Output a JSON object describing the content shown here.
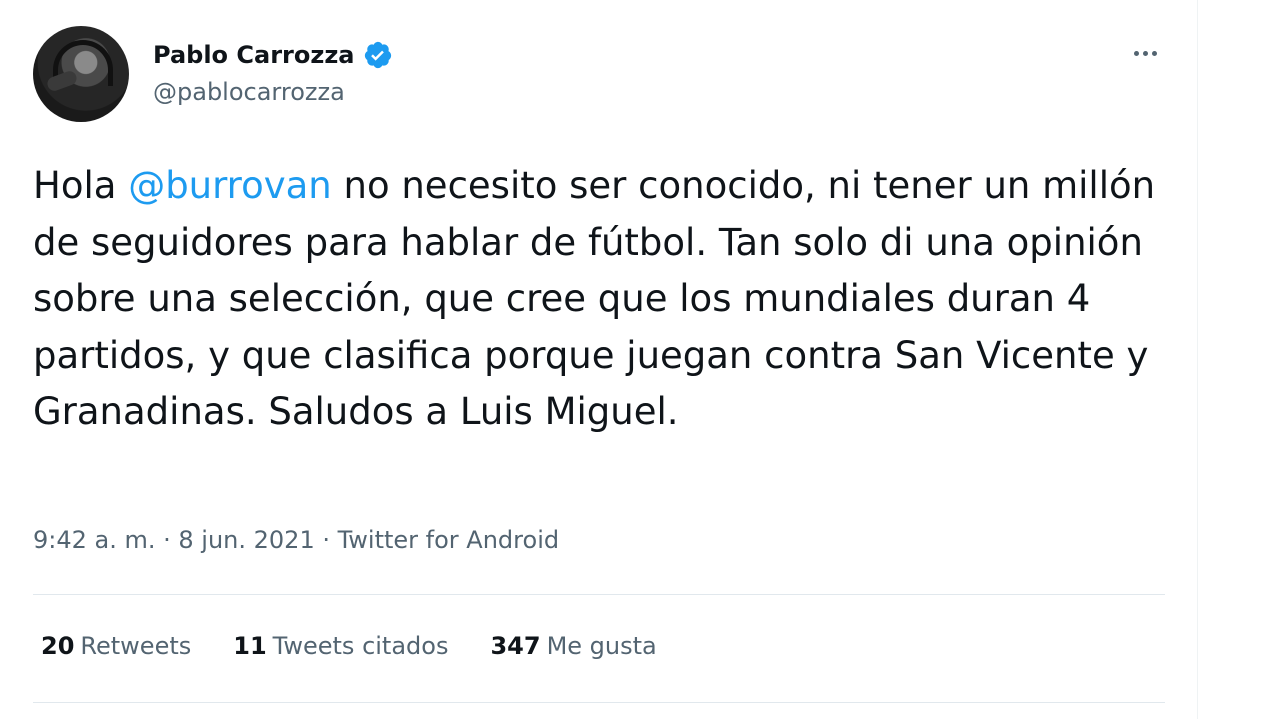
{
  "author": {
    "display_name": "Pablo Carrozza",
    "handle": "@pablocarrozza",
    "verified_icon": "verified-badge-icon",
    "verified_color": "#1d9bf0"
  },
  "tweet": {
    "text_before": "Hola ",
    "mention": "@burrovan",
    "text_after": " no necesito ser conocido, ni tener un millón de seguidores para hablar de fútbol. Tan solo di una opinión sobre una selección, que cree que los mundiales duran 4 partidos, y que clasifica porque juegan contra San Vicente y Granadinas. Saludos a Luis Miguel."
  },
  "meta": {
    "time": "9:42 a. m.",
    "separator": " · ",
    "date": "8 jun. 2021",
    "source": "Twitter for Android"
  },
  "stats": {
    "retweets_count": "20",
    "retweets_label": "Retweets",
    "quotes_count": "11",
    "quotes_label": "Tweets citados",
    "likes_count": "347",
    "likes_label": "Me gusta"
  },
  "colors": {
    "accent": "#1d9bf0",
    "secondary_text": "#536471",
    "primary_text": "#0f1419"
  }
}
